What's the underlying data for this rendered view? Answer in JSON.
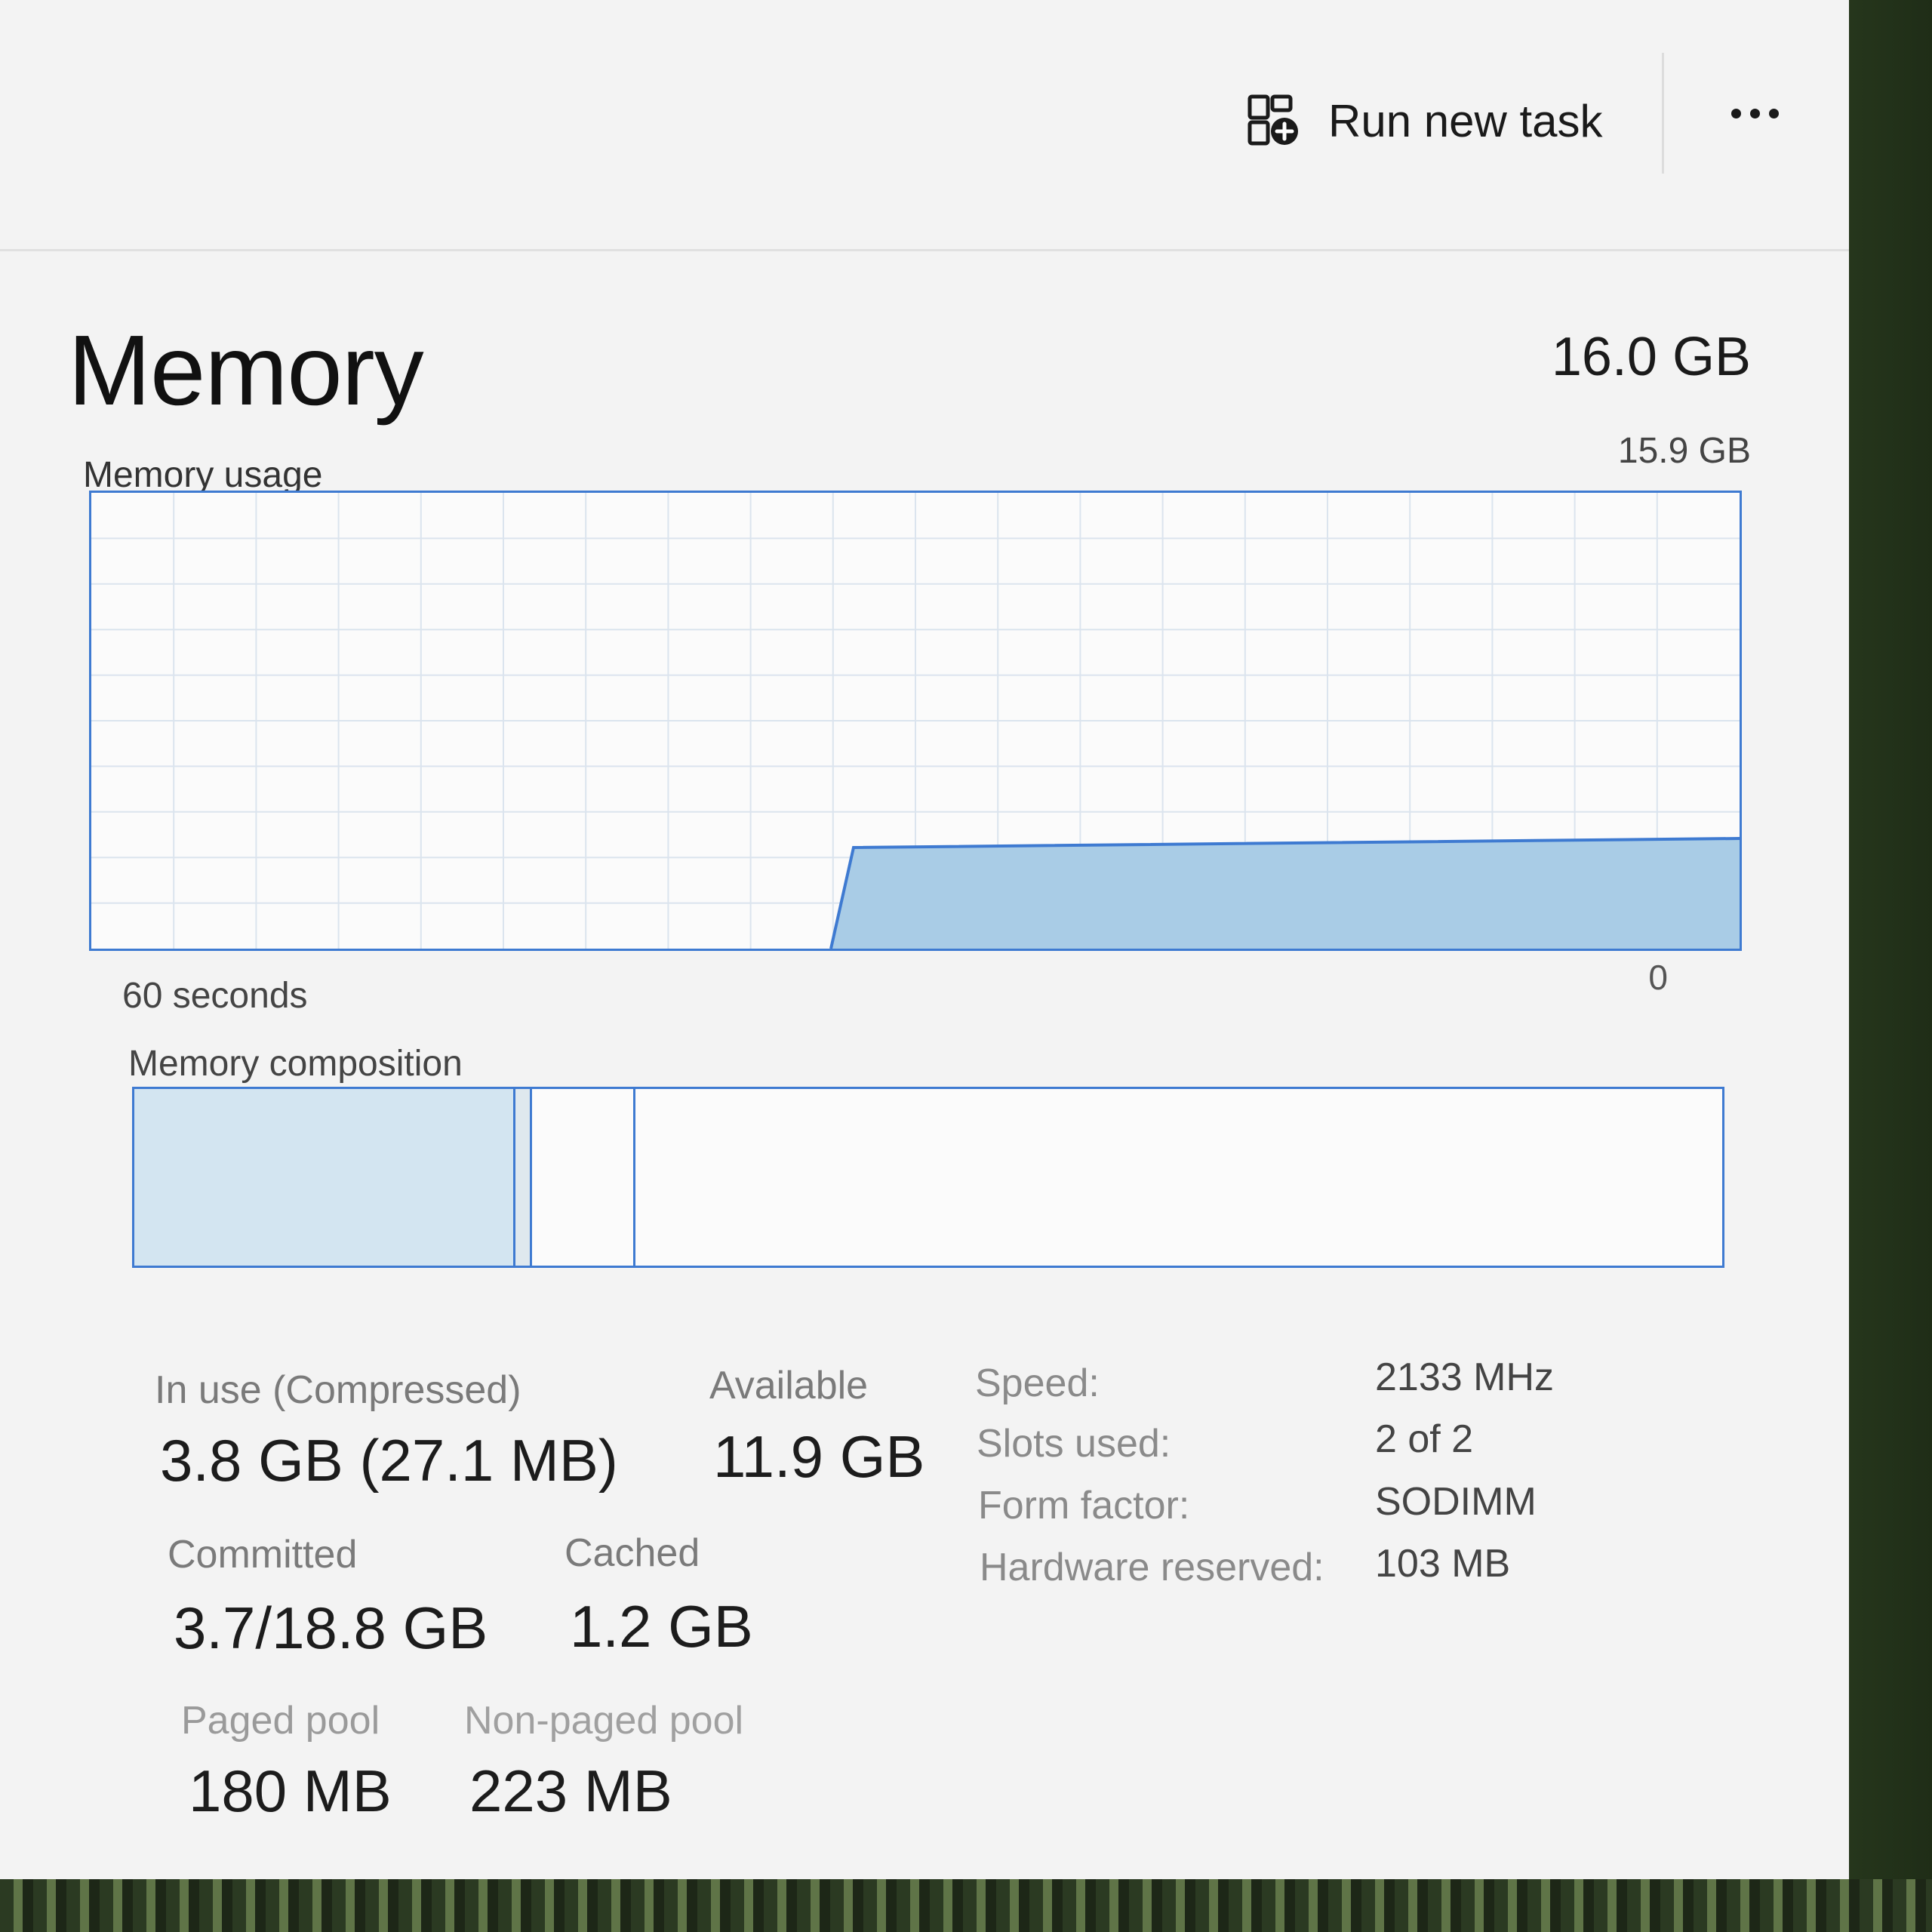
{
  "toolbar": {
    "run_new_task_label": "Run new task",
    "run_new_task_icon": "run-task-icon",
    "more_icon": "more-options-icon"
  },
  "header": {
    "title": "Memory",
    "total": "16.0 GB"
  },
  "usage_graph": {
    "label": "Memory usage",
    "max_label": "15.9 GB",
    "time_label": "60 seconds",
    "zero_label": "0",
    "accent_color": "#3e7ad1",
    "fill_color": "#a9cce6"
  },
  "composition": {
    "label": "Memory composition"
  },
  "stats": {
    "in_use_label": "In use (Compressed)",
    "in_use_value": "3.8 GB (27.1 MB)",
    "available_label": "Available",
    "available_value": "11.9 GB",
    "committed_label": "Committed",
    "committed_value": "3.7/18.8 GB",
    "cached_label": "Cached",
    "cached_value": "1.2 GB",
    "paged_pool_label": "Paged pool",
    "paged_pool_value": "180 MB",
    "non_paged_pool_label": "Non-paged pool",
    "non_paged_pool_value": "223 MB"
  },
  "specs": {
    "speed_label": "Speed:",
    "speed_value": "2133 MHz",
    "slots_label": "Slots used:",
    "slots_value": "2 of 2",
    "form_factor_label": "Form factor:",
    "form_factor_value": "SODIMM",
    "hw_reserved_label": "Hardware reserved:",
    "hw_reserved_value": "103 MB"
  }
}
